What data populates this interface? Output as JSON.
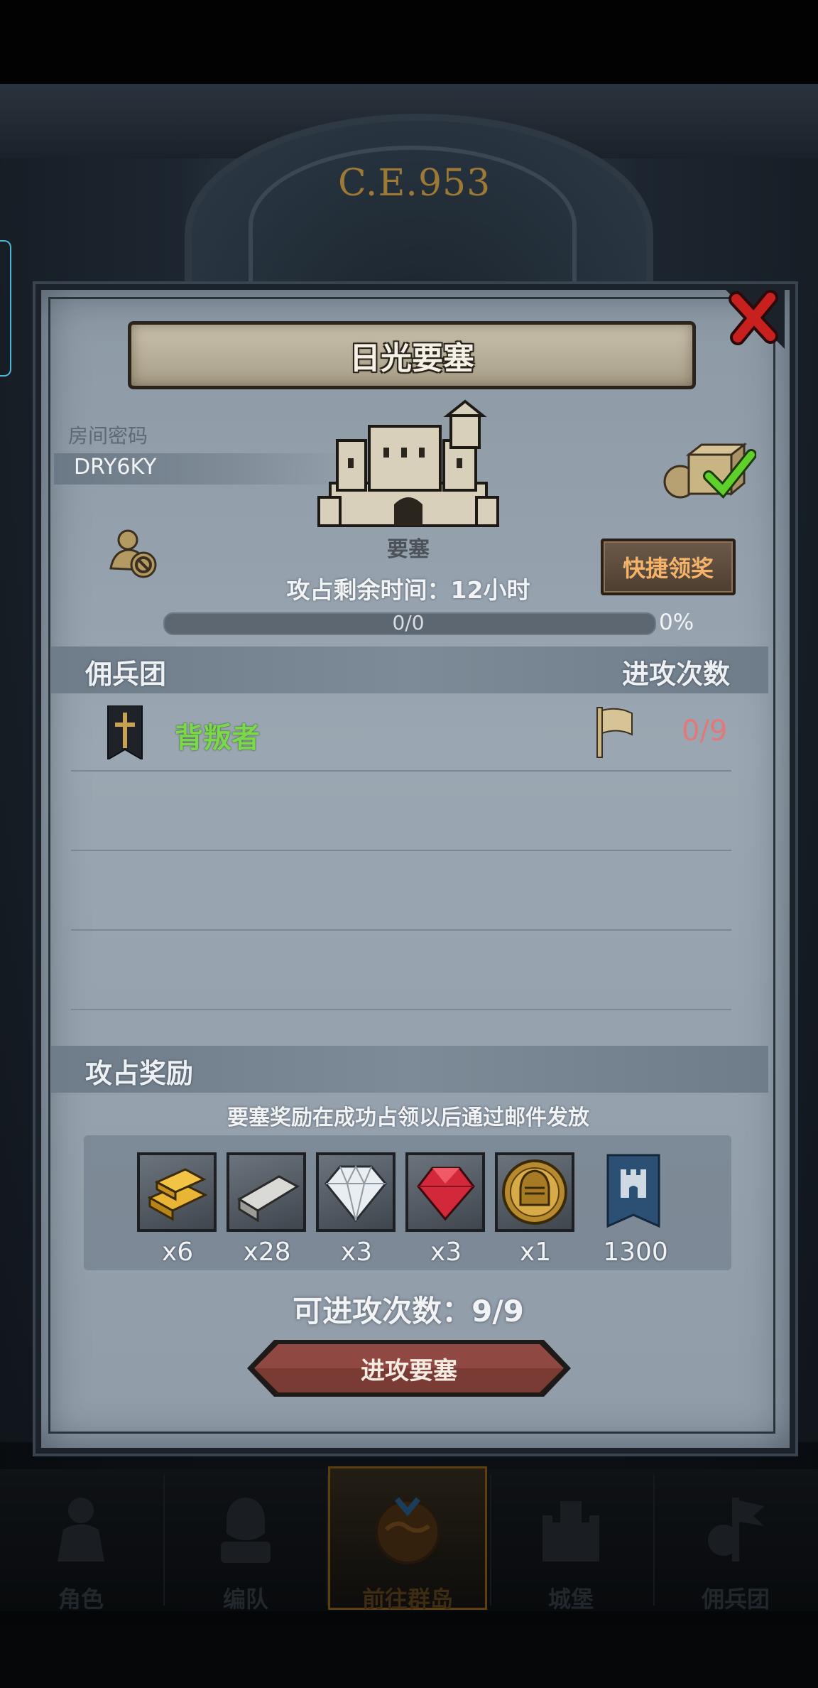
{
  "background": {
    "era_label": "C.E.953"
  },
  "modal": {
    "title": "日光要塞",
    "room_label": "房间密码",
    "room_code": "DRY6KY",
    "fortress_label": "要塞",
    "quick_claim_label": "快捷领奖",
    "time_remaining": "攻占剩余时间：12小时",
    "progress_text": "0/0",
    "progress_percent": "0%",
    "progress_fraction": 0
  },
  "mercenaries": {
    "header_left": "佣兵团",
    "header_right": "进攻次数",
    "rows": [
      {
        "name": "背叛者",
        "attacks": "0/9"
      }
    ]
  },
  "rewards": {
    "header": "攻占奖励",
    "note": "要塞奖励在成功占领以后通过邮件发放",
    "items": [
      {
        "icon": "gold-bar-icon",
        "qty": "x6"
      },
      {
        "icon": "silver-bar-icon",
        "qty": "x28"
      },
      {
        "icon": "diamond-icon",
        "qty": "x3"
      },
      {
        "icon": "ruby-icon",
        "qty": "x3"
      },
      {
        "icon": "helmet-coin-icon",
        "qty": "x1"
      },
      {
        "icon": "fortress-banner-icon",
        "qty": "1300"
      }
    ]
  },
  "attempts_text": "可进攻次数：9/9",
  "attack_button_label": "进攻要塞",
  "nav": {
    "items": [
      {
        "label": "角色",
        "icon": "character-icon"
      },
      {
        "label": "编队",
        "icon": "formation-icon"
      },
      {
        "label": "前往群岛",
        "icon": "globe-icon",
        "active": true
      },
      {
        "label": "城堡",
        "icon": "castle-icon"
      },
      {
        "label": "佣兵团",
        "icon": "mercenary-icon"
      }
    ]
  },
  "colors": {
    "merc_name": "#7ad94a",
    "attack_count": "#e07a7a",
    "quick_claim_text": "#f4b36a",
    "nav_active_border": "#a36f1d"
  }
}
